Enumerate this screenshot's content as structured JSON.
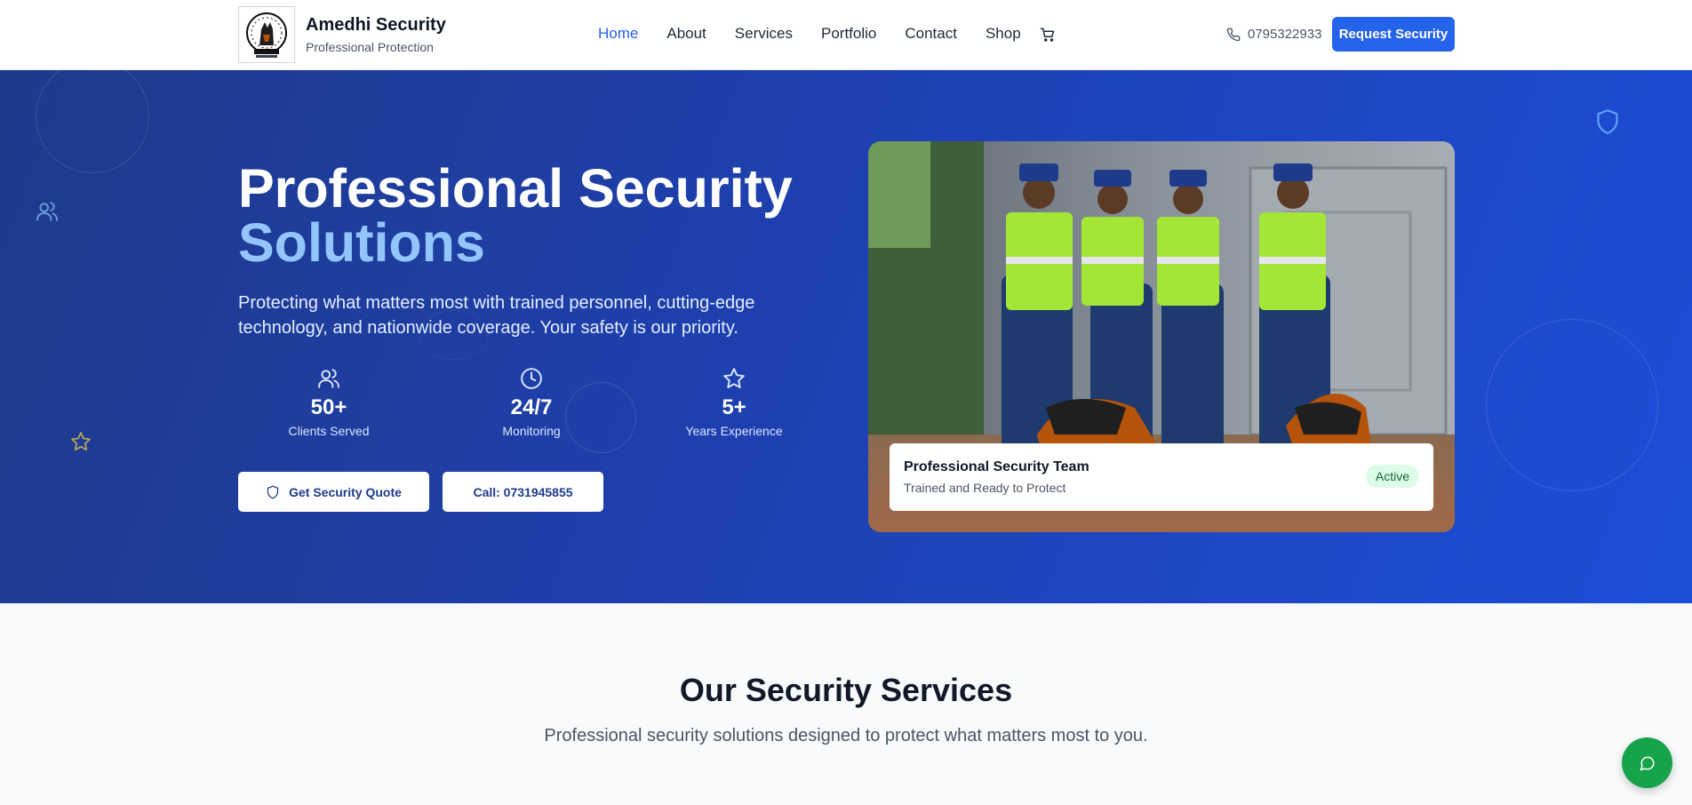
{
  "header": {
    "brand_name": "Amedhi Security",
    "brand_tagline": "Professional Protection",
    "nav": [
      "Home",
      "About",
      "Services",
      "Portfolio",
      "Contact",
      "Shop"
    ],
    "active_nav": "Home",
    "phone": "0795322933",
    "request_label": "Request Security",
    "icons": {
      "cart": "cart-icon",
      "phone": "phone-icon"
    }
  },
  "hero": {
    "title_line1": "Professional Security",
    "title_line2": "Solutions",
    "subtitle": "Protecting what matters most with trained personnel, cutting-edge technology, and nationwide coverage. Your safety is our priority.",
    "stats": [
      {
        "icon": "users-icon",
        "value": "50+",
        "label": "Clients Served"
      },
      {
        "icon": "clock-icon",
        "value": "24/7",
        "label": "Monitoring"
      },
      {
        "icon": "star-icon",
        "value": "5+",
        "label": "Years Experience"
      }
    ],
    "quote_button": "Get Security Quote",
    "call_button": "Call: 0731945855",
    "photo_card": {
      "title": "Professional Security Team",
      "subtitle": "Trained and Ready to Protect",
      "badge": "Active"
    }
  },
  "services": {
    "title": "Our Security Services",
    "subtitle": "Professional security solutions designed to protect what matters most to you."
  },
  "colors": {
    "primary": "#2563eb",
    "hero_bg": "#1e40af",
    "accent_text": "#93c5fd",
    "chat_green": "#16a34a"
  }
}
